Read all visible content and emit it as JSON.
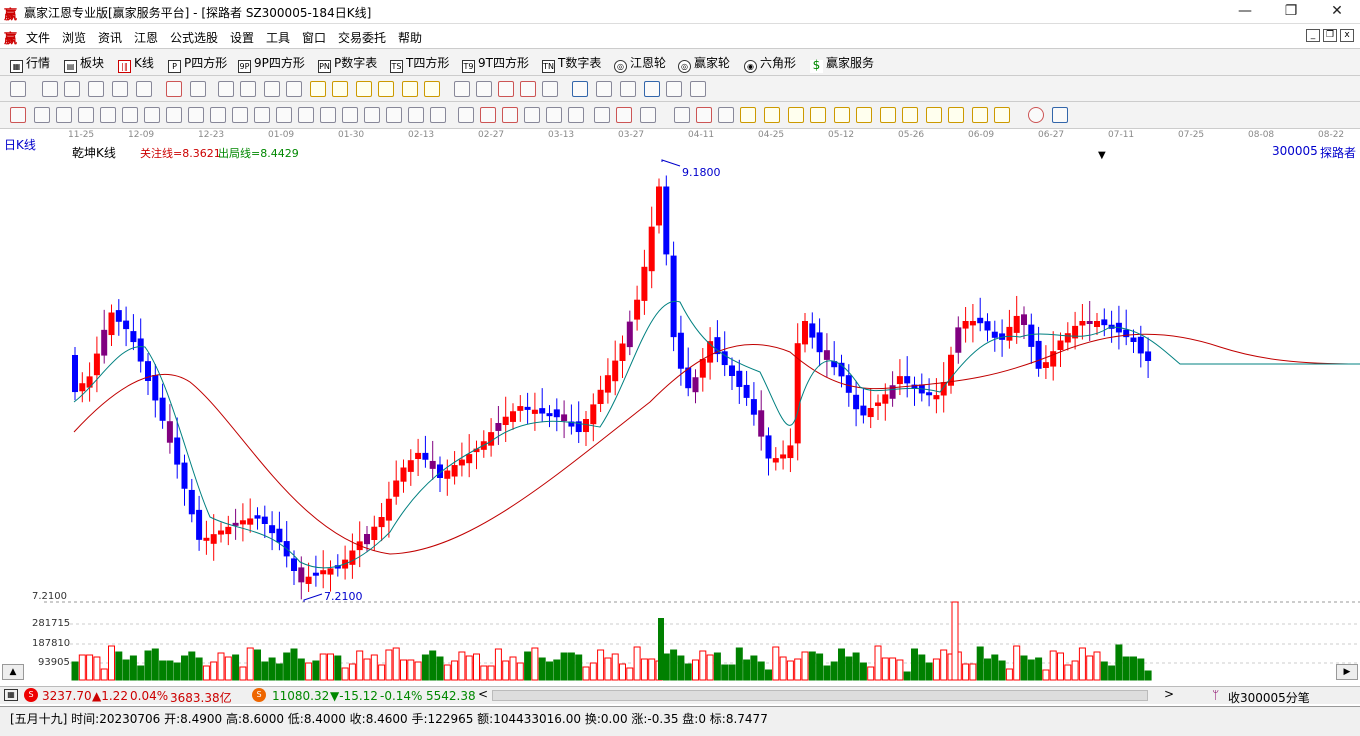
{
  "window": {
    "title": "赢家江恩专业版[赢家服务平台] - [探路者   SZ300005-184日K线]",
    "logo": "赢"
  },
  "menu": [
    "文件",
    "浏览",
    "资讯",
    "江恩",
    "公式选股",
    "设置",
    "工具",
    "窗口",
    "交易委托",
    "帮助"
  ],
  "toolbar1": [
    {
      "label": "行情",
      "icon": "quote-icon"
    },
    {
      "label": "板块",
      "icon": "sector-icon"
    },
    {
      "label": "K线",
      "icon": "kline-icon"
    },
    {
      "label": "P四方形",
      "icon": "P"
    },
    {
      "label": "9P四方形",
      "icon": "9P"
    },
    {
      "label": "P数字表",
      "icon": "PN"
    },
    {
      "label": "T四方形",
      "icon": "TS"
    },
    {
      "label": "9T四方形",
      "icon": "T9"
    },
    {
      "label": "T数字表",
      "icon": "TN"
    },
    {
      "label": "江恩轮",
      "icon": "gann-wheel-icon"
    },
    {
      "label": "赢家轮",
      "icon": "winner-wheel-icon"
    },
    {
      "label": "六角形",
      "icon": "hexagon-icon"
    },
    {
      "label": "赢家服务",
      "icon": "dollar-icon"
    }
  ],
  "chart": {
    "period_label": "日K线",
    "indicator_name": "乾坤K线",
    "focus_line": "关注线=8.3621",
    "exit_line": "出局线=8.4429",
    "code": "300005",
    "name": "探路者",
    "high_label": "9.1800",
    "low_label": "7.2100",
    "axis_low": "7.2100",
    "dates": [
      "11-25",
      "12-09",
      "12-23",
      "01-09",
      "01-30",
      "02-13",
      "02-27",
      "03-13",
      "03-27",
      "04-11",
      "04-25",
      "05-12",
      "05-26",
      "06-09",
      "06-27",
      "07-11",
      "07-25",
      "08-08",
      "08-22"
    ],
    "volume_ticks": [
      "281715",
      "187810",
      "93905"
    ],
    "colors": {
      "up": "#ff0000",
      "down": "#0000ff",
      "flat": "#800080",
      "slow_ma": "#c00000",
      "fast_ma": "#008080",
      "vol_up": "#ff0000",
      "vol_down": "#008000"
    }
  },
  "statusbar": {
    "sh_index": "3237.70",
    "sh_change": "▲1.22",
    "sh_pct": "0.04%",
    "sh_amount": "3683.38亿",
    "sz_index": "11080.32",
    "sz_change": "▼-15.12",
    "sz_pct": "-0.14%",
    "sz_amount": "5542.38",
    "ticker": "收300005分笔"
  },
  "infobar": {
    "text": "[五月十九] 时间:20230706 开:8.4900 高:8.6000 低:8.4000 收:8.4600 手:122965 额:104433016.00 换:0.00 涨:-0.35 盘:0 标:8.7477"
  }
}
